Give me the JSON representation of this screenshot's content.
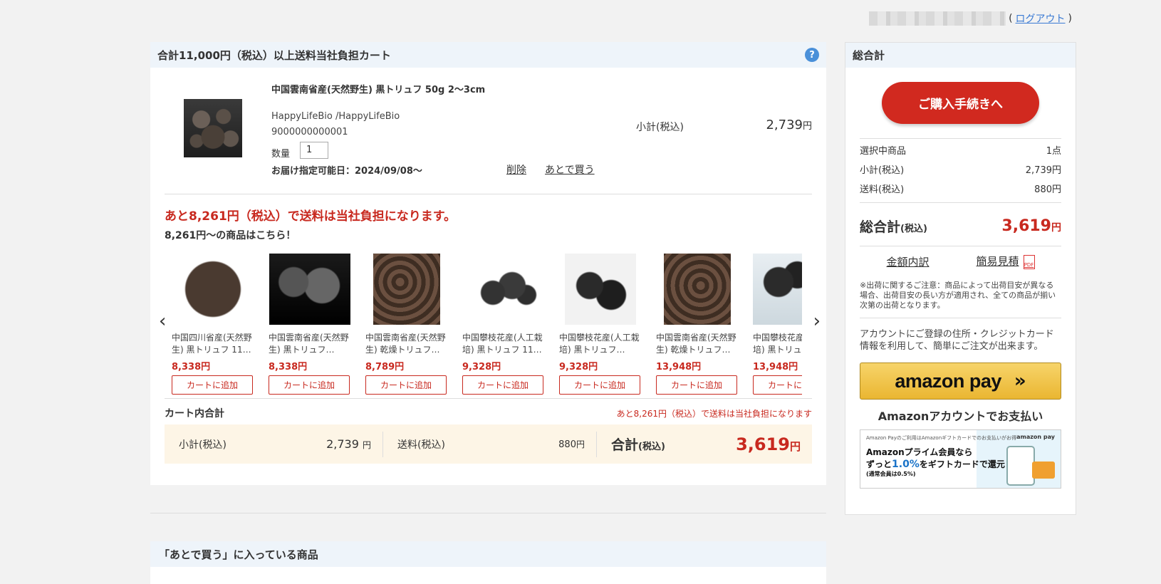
{
  "user": {
    "logout_label": "ログアウト"
  },
  "cart": {
    "header": "合計11,000円（税込）以上送料当社負担カート",
    "help": "?",
    "item": {
      "name": "中国雲南省産(天然野生) 黒トリュフ 50g 2〜3cm",
      "shop": "HappyLifeBio /HappyLifeBio",
      "code": "9000000000001",
      "qty_label": "数量",
      "qty_value": "1",
      "delivery": "お届け指定可能日：2024/09/08〜",
      "delete_label": "削除",
      "later_label": "あとで買う",
      "subtotal_label": "小計(税込)",
      "subtotal_value": "2,739",
      "yen": "円"
    },
    "free_shipping_msg": "あと8,261円（税込）で送料は当社負担になります。",
    "free_shipping_sub": "8,261円〜の商品はこちら！",
    "carousel": {
      "prev": "‹",
      "next": "›",
      "products": [
        {
          "name": "中国四川省産(天然野生) 黒トリュフ 11…",
          "price": "8,338円",
          "button": "カートに追加"
        },
        {
          "name": "中国雲南省産(天然野生) 黒トリュフ…",
          "price": "8,338円",
          "button": "カートに追加"
        },
        {
          "name": "中国雲南省産(天然野生) 乾燥トリュフ…",
          "price": "8,789円",
          "button": "カートに追加"
        },
        {
          "name": "中国攀枝花産(人工栽培) 黒トリュフ 11…",
          "price": "9,328円",
          "button": "カートに追加"
        },
        {
          "name": "中国攀枝花産(人工栽培) 黒トリュフ…",
          "price": "9,328円",
          "button": "カートに追加"
        },
        {
          "name": "中国雲南省産(天然野生) 乾燥トリュフ…",
          "price": "13,948円",
          "button": "カートに追加"
        },
        {
          "name": "中国攀枝花産(人工栽培) 黒トリュフ",
          "price": "13,948円",
          "button": "カートに追加"
        }
      ]
    },
    "total": {
      "title": "カート内合計",
      "note": "あと8,261円（税込）で送料は当社負担になります",
      "subtotal_label": "小計(税込)",
      "subtotal_value": "2,739",
      "shipping_label": "送料(税込)",
      "shipping_value": "880",
      "grand_label": "合計",
      "tax_label": "(税込)",
      "grand_value": "3,619",
      "yen": "円"
    }
  },
  "later": {
    "header": "「あとで買う」に入っている商品"
  },
  "summary": {
    "header": "総合計",
    "buy_button": "ご購入手続きへ",
    "rows": [
      {
        "label": "選択中商品",
        "value": "1点"
      },
      {
        "label": "小計(税込)",
        "value": "2,739円"
      },
      {
        "label": "送料(税込)",
        "value": "880円"
      }
    ],
    "grand_label": "総合計",
    "tax_label": "(税込)",
    "grand_value": "3,619",
    "yen": "円",
    "breakdown_link": "金額内訳",
    "estimate_link": "簡易見積",
    "pdf": "PDF",
    "ship_note": "※出荷に関するご注意：商品によって出荷目安が異なる場合、出荷目安の長い方が適用され、全ての商品が揃い次第の出荷となります。",
    "account_note": "アカウントにご登録の住所・クレジットカード情報を利用して、簡単にご注文が出来ます。",
    "amazon_logo": "amazon pay",
    "amazon_chevron": "»",
    "amazon_caption": "Amazonアカウントでお支払い",
    "banner": {
      "small": "Amazon Payのご利用はAmazonギフトカードでのお支払いがお得",
      "brand": "amazon pay",
      "line1": "Amazonプライム会員なら",
      "line2_pre": "ずっと",
      "line2_pct": "1.0%",
      "line2_post": "をギフトカードで還元",
      "line3": "(通常会員は0.5%)"
    }
  }
}
